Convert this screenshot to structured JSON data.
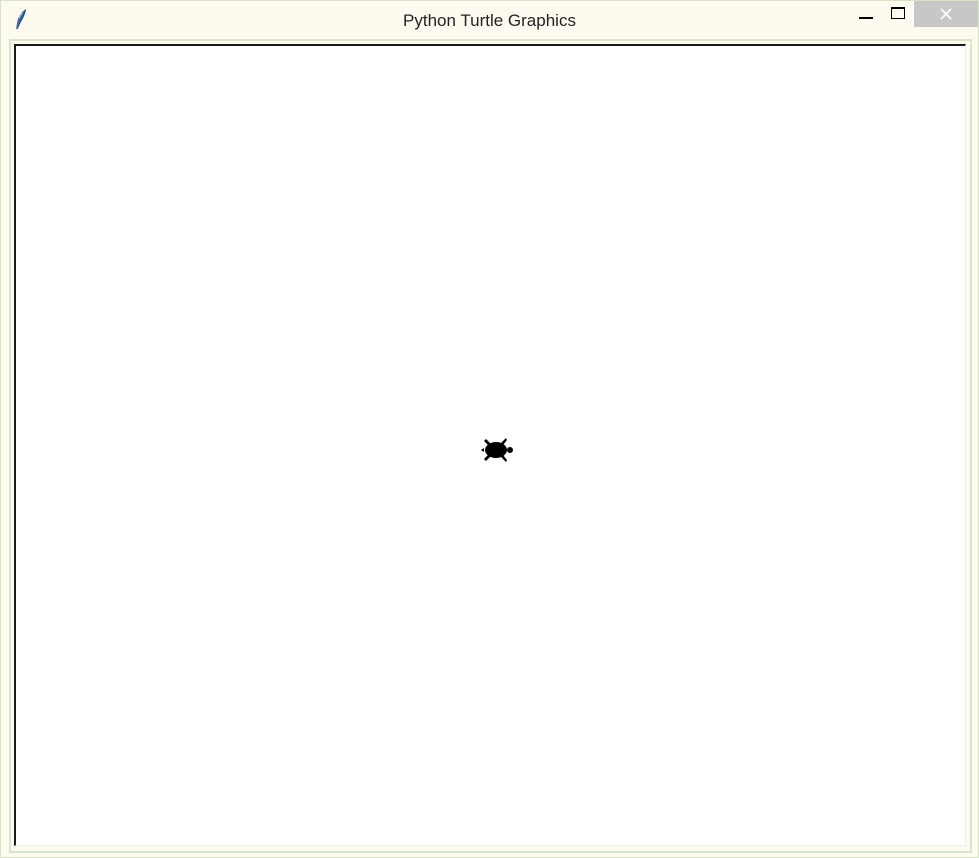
{
  "window": {
    "title": "Python Turtle Graphics",
    "app_icon": "feather-icon",
    "controls": {
      "minimize": "minimize-icon",
      "maximize": "maximize-icon",
      "close": "close-icon"
    }
  },
  "canvas": {
    "background": "#ffffff",
    "turtle": {
      "icon": "turtle-icon",
      "color": "#000000",
      "heading": "east"
    }
  }
}
